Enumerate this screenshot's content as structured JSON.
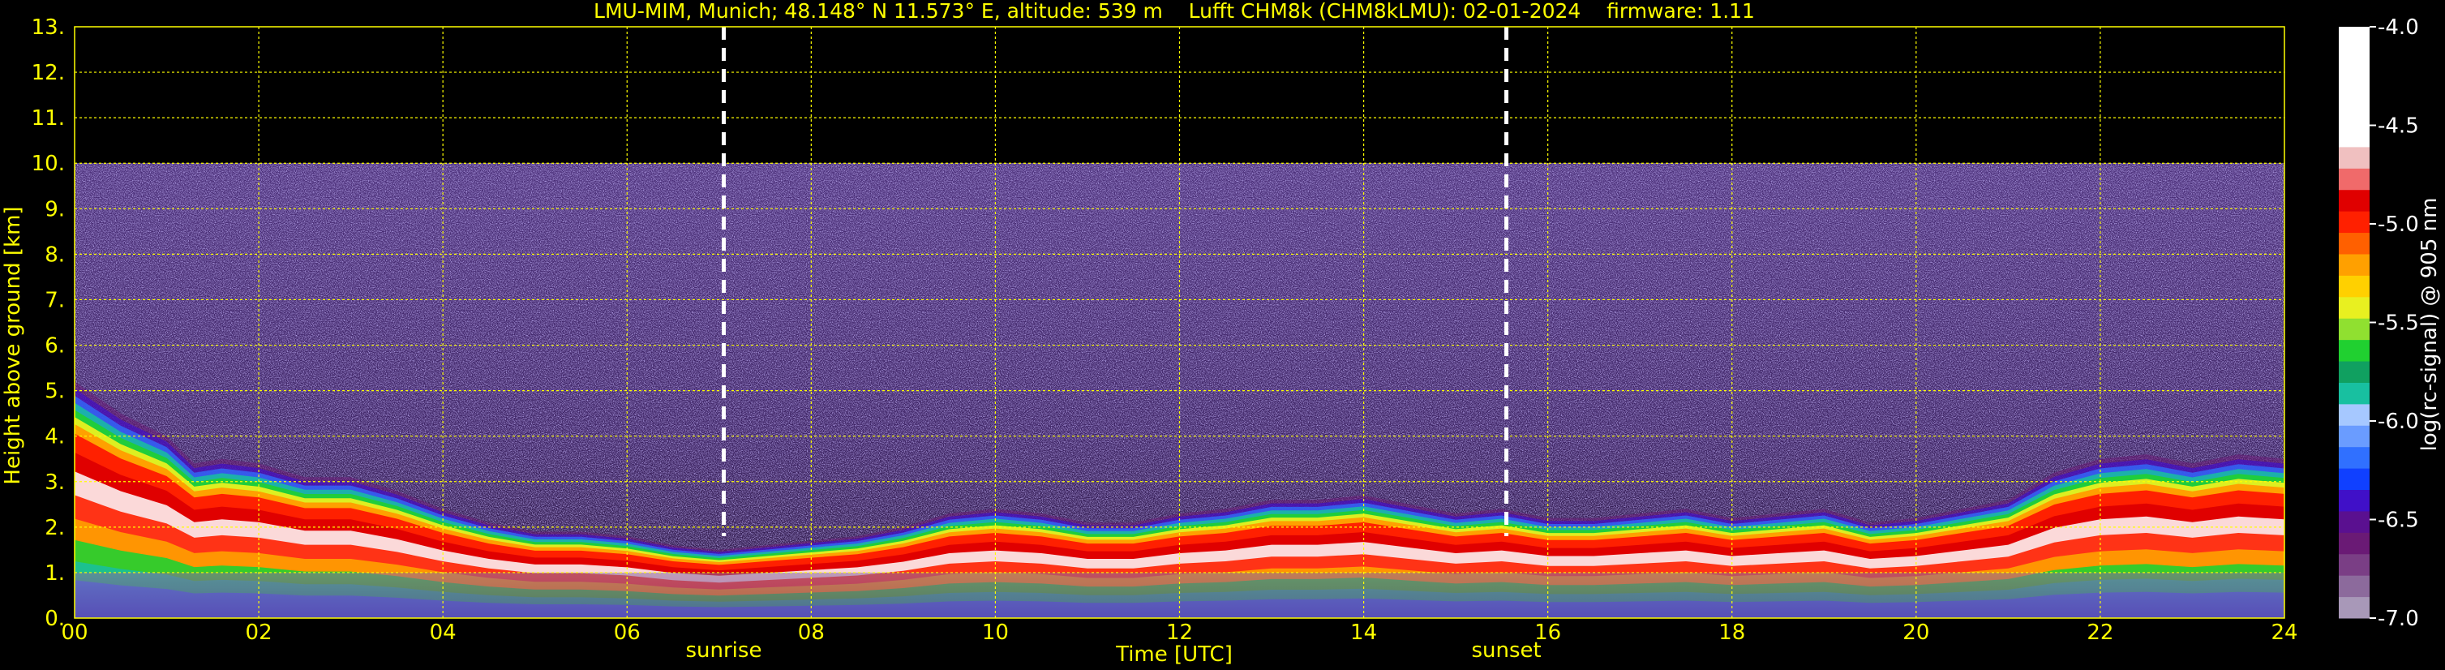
{
  "chart_data": {
    "type": "heatmap",
    "title": "LMU-MIM, Munich; 48.148° N 11.573° E, altitude: 539 m    Lufft CHM8k (CHM8kLMU): 02-01-2024    firmware: 1.11",
    "xlabel": "Time [UTC]",
    "ylabel": "Height above ground [km]",
    "xlim": [
      0,
      24
    ],
    "ylim": [
      0,
      13
    ],
    "x_ticks": [
      "00",
      "02",
      "04",
      "06",
      "08",
      "10",
      "12",
      "14",
      "16",
      "18",
      "20",
      "22",
      "24"
    ],
    "y_ticks": [
      "0.",
      "1.",
      "2.",
      "3.",
      "4.",
      "5.",
      "6.",
      "7.",
      "8.",
      "9.",
      "10.",
      "11.",
      "12.",
      "13."
    ],
    "grid": true,
    "data_top_km": 10,
    "annotations": [
      {
        "label": "sunrise",
        "x": 7.05
      },
      {
        "label": "sunset",
        "x": 15.55
      }
    ],
    "boundary_layer_top_km": {
      "x": [
        0,
        0.5,
        1.0,
        1.3,
        1.6,
        2.0,
        2.5,
        3.0,
        3.5,
        4.0,
        4.5,
        5.0,
        5.5,
        6.0,
        6.5,
        7.0,
        7.5,
        8.0,
        8.5,
        9.0,
        9.5,
        10.0,
        10.5,
        11.0,
        11.5,
        12.0,
        12.5,
        13.0,
        13.5,
        14.0,
        14.5,
        15.0,
        15.5,
        16.0,
        16.5,
        17.0,
        17.5,
        18.0,
        18.5,
        19.0,
        19.5,
        20.0,
        20.5,
        21.0,
        21.5,
        22.0,
        22.5,
        23.0,
        23.5,
        24.0
      ],
      "y": [
        5.2,
        4.5,
        4.0,
        3.4,
        3.5,
        3.4,
        3.1,
        3.1,
        2.8,
        2.4,
        2.1,
        1.9,
        1.9,
        1.8,
        1.6,
        1.5,
        1.6,
        1.7,
        1.8,
        2.0,
        2.3,
        2.4,
        2.3,
        2.1,
        2.1,
        2.3,
        2.4,
        2.6,
        2.6,
        2.7,
        2.5,
        2.3,
        2.4,
        2.2,
        2.2,
        2.3,
        2.4,
        2.2,
        2.3,
        2.4,
        2.1,
        2.2,
        2.4,
        2.6,
        3.2,
        3.5,
        3.6,
        3.4,
        3.6,
        3.5
      ]
    },
    "colorbar": {
      "label": "log(rc-signal) @ 905 nm",
      "range": [
        -7.0,
        -4.0
      ],
      "ticks": [
        "-4.0",
        "-4.5",
        "-5.0",
        "-5.5",
        "-6.0",
        "-6.5",
        "-7.0"
      ],
      "colors": [
        "#a898b8",
        "#8c6a9c",
        "#7a3e85",
        "#6a1a75",
        "#5a1090",
        "#4010c8",
        "#1040ff",
        "#3070ff",
        "#6a9cff",
        "#a6c8ff",
        "#18c0a0",
        "#10a060",
        "#20d030",
        "#90e030",
        "#e8f020",
        "#ffd000",
        "#ffa000",
        "#ff6000",
        "#ff2000",
        "#e00000",
        "#f06a6a",
        "#f0c0c0",
        "#ffffff"
      ]
    }
  }
}
